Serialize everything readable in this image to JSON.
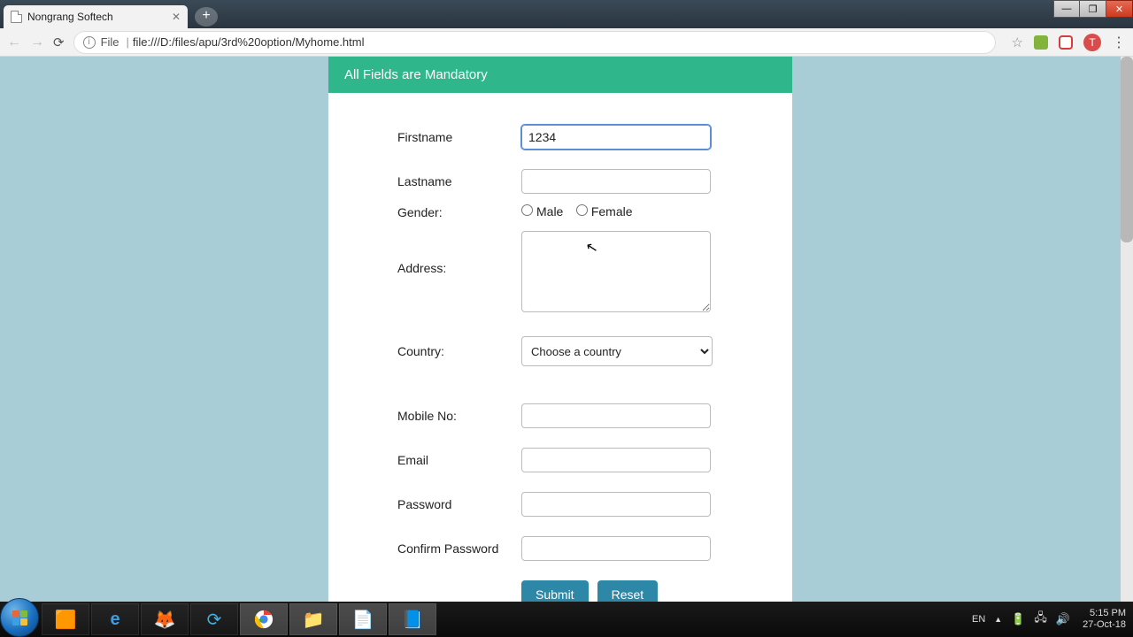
{
  "browser": {
    "tab_title": "Nongrang Softech",
    "url_scheme": "File",
    "url_path": "file:///D:/files/apu/3rd%20option/Myhome.html"
  },
  "form": {
    "header": "All Fields are Mandatory",
    "labels": {
      "firstname": "Firstname",
      "lastname": "Lastname",
      "gender": "Gender:",
      "address": "Address:",
      "country": "Country:",
      "mobile": "Mobile No:",
      "email": "Email",
      "password": "Password",
      "confirm": "Confirm Password"
    },
    "values": {
      "firstname": "1234"
    },
    "gender_options": {
      "male": "Male",
      "female": "Female"
    },
    "country_placeholder": "Choose a country",
    "buttons": {
      "submit": "Submit",
      "reset": "Reset"
    }
  },
  "system": {
    "lang": "EN",
    "time": "5:15 PM",
    "date": "27-Oct-18"
  }
}
